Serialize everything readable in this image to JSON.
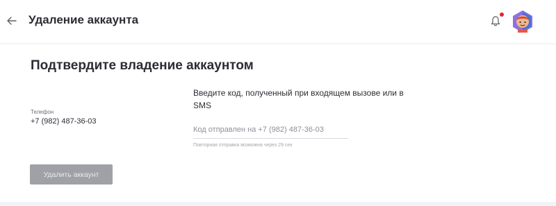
{
  "header": {
    "title": "Удаление аккаунта",
    "back_icon": "arrow-left-icon",
    "bell_icon": "bell-icon",
    "has_notification": true,
    "notification_color": "#e3262f"
  },
  "confirm": {
    "title": "Подтвердите владение аккаунтом",
    "phone_label": "Телефон",
    "phone_value": "+7 (982) 487-36-03",
    "instruction": "Введите код, полученный при входящем вызове или в SMS",
    "code_input": {
      "value": "",
      "placeholder": "Код отправлен на +7 (982) 487-36-03"
    },
    "resend_hint": "Повторная отправка возможна через 29 сек",
    "delete_button": "Удалить аккаунт",
    "delete_button_disabled": true
  },
  "colors": {
    "background": "#f2f3f6",
    "text": "#2b2d33",
    "button_disabled": "#9fa1a6"
  }
}
